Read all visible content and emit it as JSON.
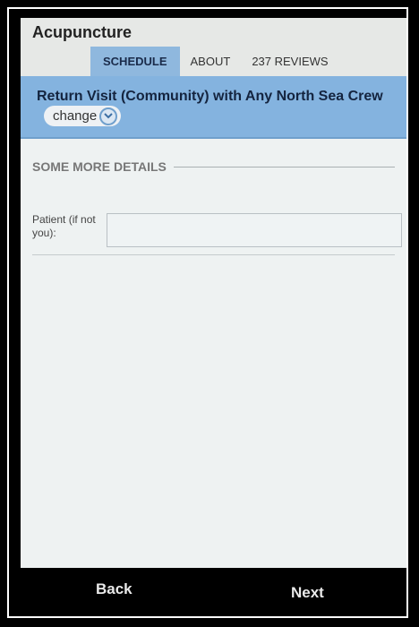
{
  "header": {
    "title": "Acupuncture",
    "tabs": [
      {
        "label": "SCHEDULE",
        "active": true
      },
      {
        "label": "ABOUT",
        "active": false
      },
      {
        "label": "237 REVIEWS",
        "active": false
      }
    ]
  },
  "visit": {
    "description": "Return Visit (Community) with Any North Sea Crew",
    "change_label": "change",
    "change_icon": "chevron-down-circle-icon"
  },
  "details": {
    "section_title": "SOME MORE DETAILS",
    "patient_label": "Patient (if not you):",
    "patient_value": ""
  },
  "footer": {
    "back_label": "Back",
    "next_label": "Next"
  },
  "colors": {
    "tab_active_bg": "#8fb8de",
    "banner_bg": "#84b3df",
    "screen_bg": "#eef2f2",
    "bar_bg": "#000000"
  }
}
